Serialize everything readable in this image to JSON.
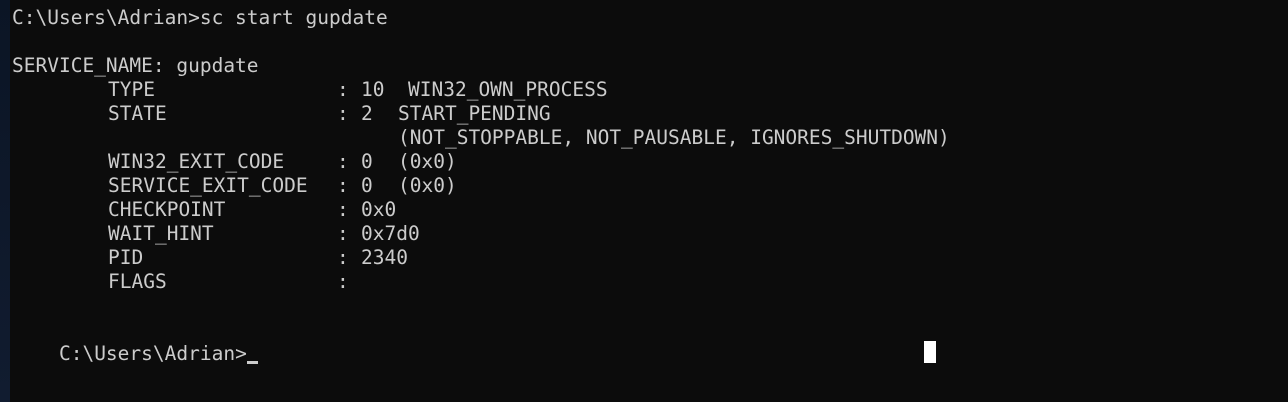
{
  "console": {
    "command_line": "C:\\Users\\Adrian>sc start gupdate",
    "service_line": "SERVICE_NAME: gupdate",
    "fields": [
      {
        "key": "TYPE",
        "val1": "10",
        "val2": "WIN32_OWN_PROCESS"
      },
      {
        "key": "STATE",
        "val1": "2",
        "val2": "START_PENDING"
      },
      {
        "continuation": "(NOT_STOPPABLE, NOT_PAUSABLE, IGNORES_SHUTDOWN)"
      },
      {
        "key": "WIN32_EXIT_CODE",
        "val1": "0",
        "val2": "(0x0)"
      },
      {
        "key": "SERVICE_EXIT_CODE",
        "val1": "0",
        "val2": "(0x0)"
      },
      {
        "key": "CHECKPOINT",
        "val1": "0x0"
      },
      {
        "key": "WAIT_HINT",
        "val1": "0x7d0"
      },
      {
        "key": "PID",
        "val1": "2340"
      },
      {
        "key": "FLAGS",
        "val1": ""
      }
    ],
    "colon": ":",
    "prompt": "C:\\Users\\Adrian>"
  },
  "colors": {
    "background": "#0c0c0c",
    "text": "#cccccc"
  }
}
